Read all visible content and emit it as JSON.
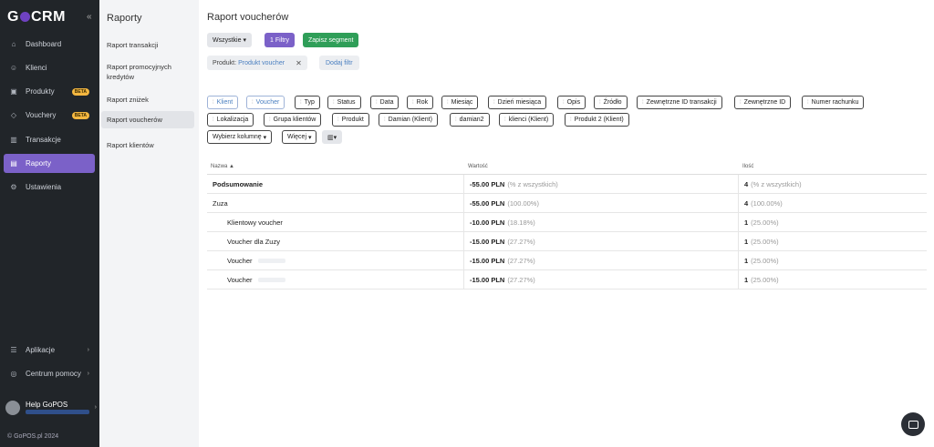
{
  "app": {
    "logo": "GoCRM",
    "copyright": "© GoPOS.pl 2024"
  },
  "sidebar": {
    "items": [
      {
        "label": "Dashboard",
        "icon": "home-icon"
      },
      {
        "label": "Klienci",
        "icon": "users-icon"
      },
      {
        "label": "Produkty",
        "icon": "box-icon",
        "badge": "BETA"
      },
      {
        "label": "Vouchery",
        "icon": "tag-icon",
        "badge": "BETA"
      },
      {
        "label": "Transakcje",
        "icon": "chart-icon"
      },
      {
        "label": "Raporty",
        "icon": "report-icon",
        "active": true
      },
      {
        "label": "Ustawienia",
        "icon": "gear-icon"
      }
    ],
    "bottom": [
      {
        "label": "Aplikacje",
        "icon": "apps-icon"
      },
      {
        "label": "Centrum pomocy",
        "icon": "help-icon"
      }
    ],
    "user": {
      "name": "Help GoPOS"
    }
  },
  "subnav": {
    "title": "Raporty",
    "items": [
      {
        "label": "Raport transakcji"
      },
      {
        "label": "Raport promocyjnych kredytów"
      },
      {
        "label": "Raport zniżek"
      },
      {
        "label": "Raport voucherów",
        "active": true
      },
      {
        "label": "Raport klientów"
      }
    ]
  },
  "main": {
    "title": "Raport voucherów",
    "toolbar": {
      "all": "Wszystkie",
      "filters": "1 Filtry",
      "save_segment": "Zapisz segment"
    },
    "filter": {
      "label": "Produkt:",
      "value": "Produkt voucher",
      "add": "Dodaj filtr"
    },
    "columns": [
      "Klient",
      "Voucher",
      "Typ",
      "Status",
      "Data",
      "Rok",
      "Miesiąc",
      "Dzień miesiąca",
      "Opis",
      "Źródło",
      "Zewnętrzne ID transakcji",
      "Zewnętrzne ID",
      "Numer rachunku",
      "Lokalizacja",
      "Grupa klientów",
      "Produkt",
      "Damian (Klient)",
      "damian2",
      "klienci (Klient)",
      "Produkt 2 (Klient)"
    ],
    "column_controls": {
      "choose": "Wybierz kolumnę",
      "more": "Więcej"
    },
    "table": {
      "headers": [
        "Nazwa",
        "Wartość",
        "Ilość"
      ],
      "rows": [
        {
          "name": "Podsumowanie",
          "value": "-55.00 PLN",
          "value_pct": "(% z wszystkich)",
          "qty": "4",
          "qty_pct": "(% z wszystkich)"
        },
        {
          "name": "Zuza",
          "value": "-55.00 PLN",
          "value_pct": "(100.00%)",
          "qty": "4",
          "qty_pct": "(100.00%)"
        },
        {
          "name": "Klientowy voucher",
          "value": "-10.00 PLN",
          "value_pct": "(18.18%)",
          "qty": "1",
          "qty_pct": "(25.00%)"
        },
        {
          "name": "Voucher dla Zuzy",
          "value": "-15.00 PLN",
          "value_pct": "(27.27%)",
          "qty": "1",
          "qty_pct": "(25.00%)"
        },
        {
          "name": "Voucher",
          "value": "-15.00 PLN",
          "value_pct": "(27.27%)",
          "qty": "1",
          "qty_pct": "(25.00%)"
        },
        {
          "name": "Voucher",
          "value": "-15.00 PLN",
          "value_pct": "(27.27%)",
          "qty": "1",
          "qty_pct": "(25.00%)"
        }
      ]
    }
  }
}
